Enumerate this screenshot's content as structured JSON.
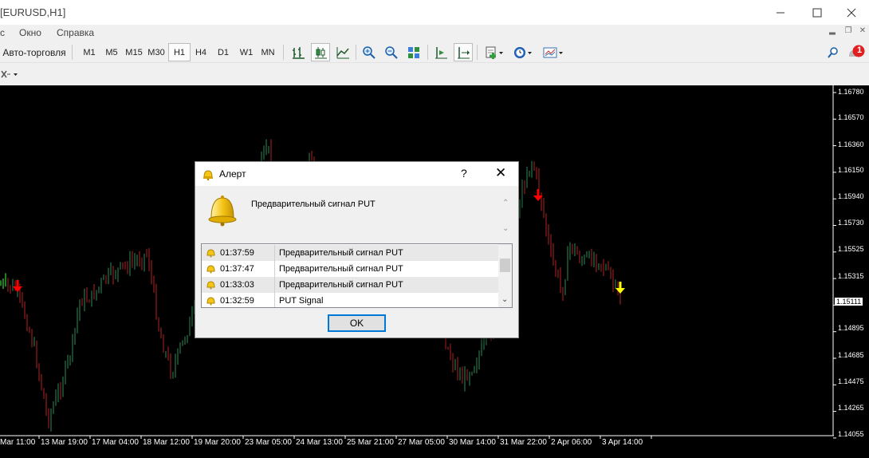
{
  "window": {
    "title": "[EURUSD,H1]"
  },
  "menu": {
    "items": [
      "с",
      "Окно",
      "Справка"
    ]
  },
  "toolbar": {
    "autotrade_label": "Авто-торговля",
    "timeframes": [
      "M1",
      "M5",
      "M15",
      "M30",
      "H1",
      "H4",
      "D1",
      "W1",
      "MN"
    ],
    "active_timeframe": "H1",
    "notification_count": "1"
  },
  "chart": {
    "price_labels": [
      "1.16780",
      "1.16570",
      "1.16360",
      "1.16150",
      "1.15940",
      "1.15730",
      "1.15525",
      "1.15315",
      "1.15111",
      "1.14895",
      "1.14685",
      "1.14475",
      "1.14265",
      "1.14055"
    ],
    "current_price": "1.15111",
    "time_labels": [
      "Mar 11:00",
      "13 Mar 19:00",
      "17 Mar 04:00",
      "18 Mar 12:00",
      "19 Mar 20:00",
      "23 Mar 05:00",
      "24 Mar 13:00",
      "25 Mar 21:00",
      "27 Mar 05:00",
      "30 Mar 14:00",
      "31 Mar 22:00",
      "2 Apr 06:00",
      "3 Apr 14:00"
    ],
    "colors": {
      "background": "#000000",
      "bull": "#2e8b57",
      "bear": "#b22222",
      "signal_red": "#ff0000",
      "signal_yellow": "#ffff00"
    }
  },
  "alert": {
    "title": "Алерт",
    "help": "?",
    "message": "Предварительный сигнал PUT",
    "rows": [
      {
        "time": "01:37:59",
        "text": "Предварительный сигнал PUT"
      },
      {
        "time": "01:37:47",
        "text": "Предварительный сигнал PUT"
      },
      {
        "time": "01:33:03",
        "text": "Предварительный сигнал PUT"
      },
      {
        "time": "01:32:59",
        "text": "PUT Signal"
      }
    ],
    "ok_label": "OK"
  }
}
